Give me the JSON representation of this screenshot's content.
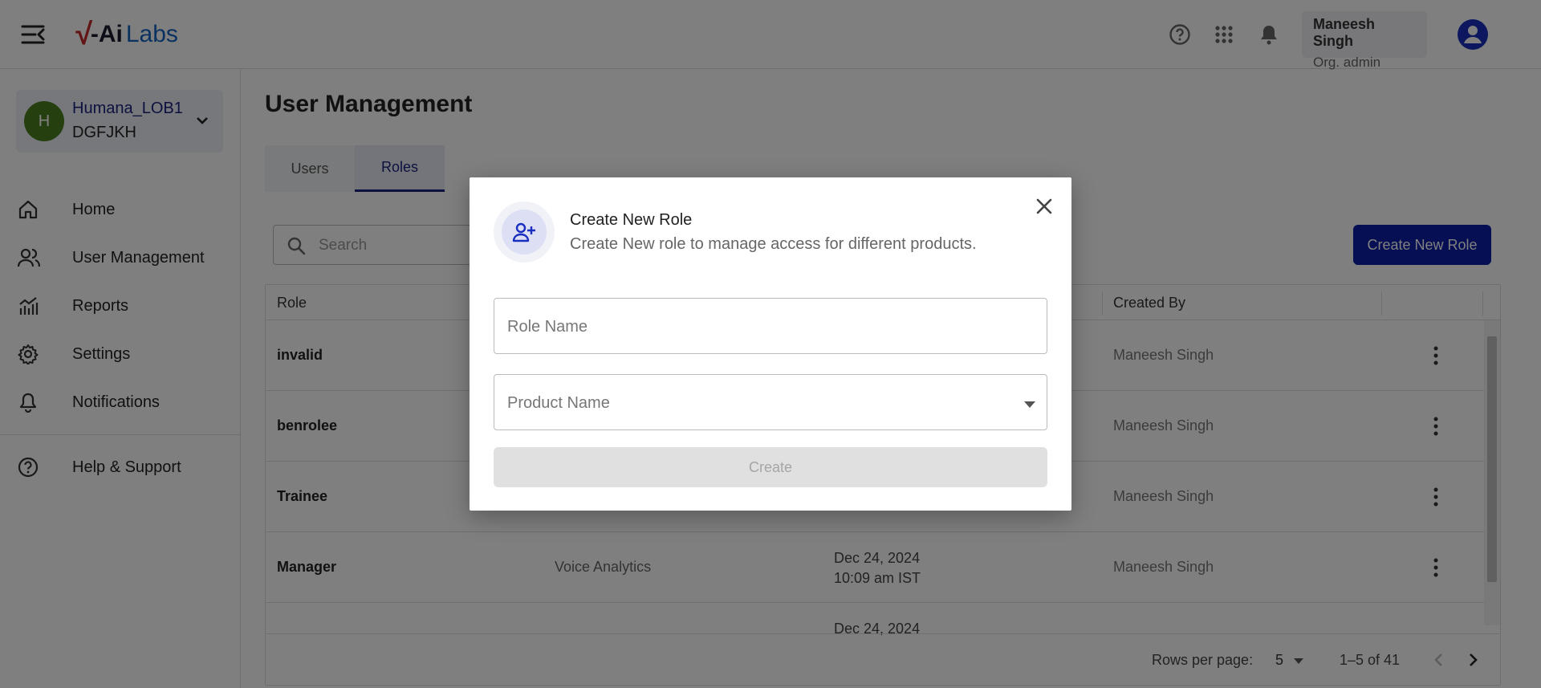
{
  "header": {
    "logo": {
      "v": "√",
      "ai": "-Ai",
      "labs": "Labs"
    },
    "user_name": "Maneesh Singh",
    "user_role": "Org. admin"
  },
  "sidebar": {
    "org_initial": "H",
    "org_name": "Humana_LOB1",
    "org_code": "DGFJKH",
    "items": [
      {
        "label": "Home",
        "icon": "home-icon"
      },
      {
        "label": "User Management",
        "icon": "users-icon"
      },
      {
        "label": "Reports",
        "icon": "chart-icon"
      },
      {
        "label": "Settings",
        "icon": "gear-icon"
      },
      {
        "label": "Notifications",
        "icon": "bell-icon"
      },
      {
        "label": "Help & Support",
        "icon": "help-icon"
      }
    ]
  },
  "main": {
    "title": "User Management",
    "tabs": [
      {
        "label": "Users"
      },
      {
        "label": "Roles"
      }
    ],
    "search_placeholder": "Search",
    "create_button": "Create New Role",
    "table": {
      "columns": [
        "Role",
        "Created By"
      ],
      "rows": [
        {
          "role": "invalid",
          "product": "",
          "date": "",
          "time": "",
          "created_by": "Maneesh Singh"
        },
        {
          "role": "benrolee",
          "product": "",
          "date": "",
          "time": "",
          "created_by": "Maneesh Singh"
        },
        {
          "role": "Trainee",
          "product": "",
          "date": "",
          "time": "",
          "created_by": "Maneesh Singh"
        },
        {
          "role": "Manager",
          "product": "Voice Analytics",
          "date": "Dec 24, 2024",
          "time": "10:09 am IST",
          "created_by": "Maneesh Singh"
        },
        {
          "role": "",
          "product": "",
          "date": "Dec 24, 2024",
          "time": "",
          "created_by": ""
        }
      ],
      "rows_per_page_label": "Rows per page:",
      "rows_per_page": "5",
      "range": "1–5 of 41"
    }
  },
  "modal": {
    "title": "Create New Role",
    "subtitle": "Create New role to manage access for different products.",
    "role_placeholder": "Role Name",
    "product_placeholder": "Product Name",
    "create_button": "Create"
  },
  "colors": {
    "primary": "#0d1fa8",
    "org_avatar": "#4a7f1f",
    "user_avatar": "#1a2fbf"
  }
}
